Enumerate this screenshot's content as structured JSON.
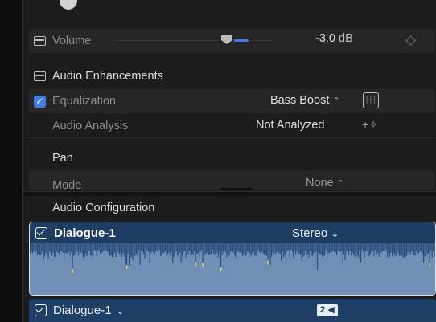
{
  "volume": {
    "label": "Volume",
    "value": "-3.0",
    "unit": "dB"
  },
  "audio_enhancements": {
    "label": "Audio Enhancements"
  },
  "equalization": {
    "label": "Equalization",
    "value": "Bass Boost",
    "chevron": "⌃⌄",
    "eq_icon_text": "┆┆┆",
    "checked": true
  },
  "audio_analysis": {
    "label": "Audio Analysis",
    "value": "Not Analyzed",
    "icon": "+✧"
  },
  "pan": {
    "label": "Pan",
    "mode_label": "Mode",
    "mode_value": "None"
  },
  "audio_configuration": {
    "label": "Audio Configuration"
  },
  "clip": {
    "name": "Dialogue-1",
    "channel_mode": "Stereo"
  },
  "subclip": {
    "name": "Dialogue-1",
    "badge": "2"
  },
  "colors": {
    "accent": "#3f7bea",
    "clip_bg": "#1e3f66",
    "waveform": "#6f8fb6",
    "waveform_peak": "#e6d65a"
  }
}
